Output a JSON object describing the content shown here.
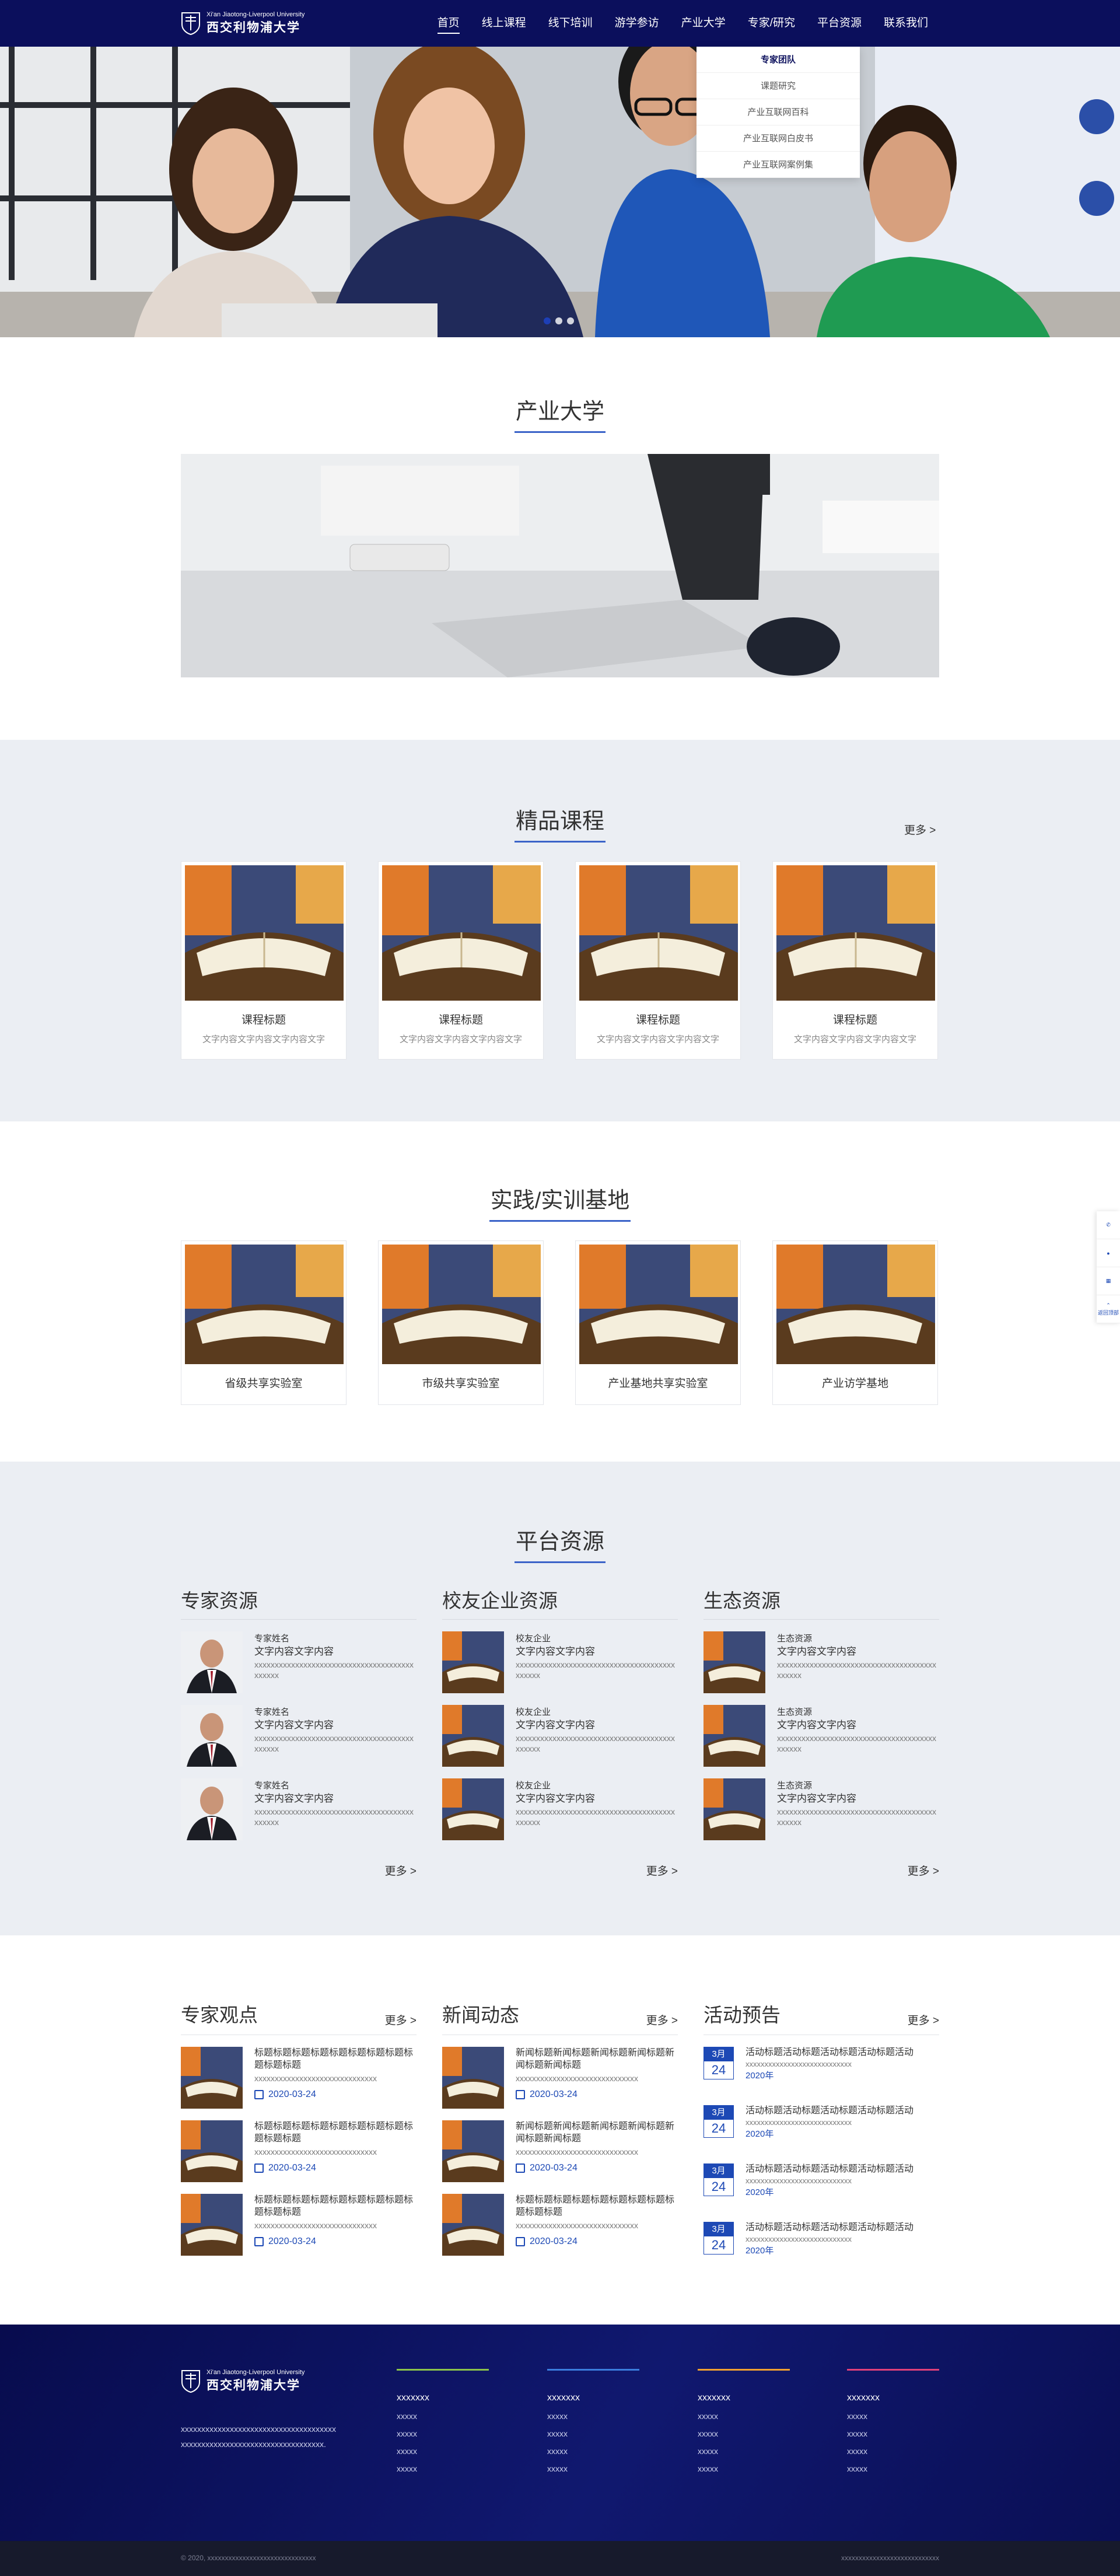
{
  "header": {
    "logo_en": "Xi'an Jiaotong-Liverpool University",
    "logo_cn": "西交利物浦大学",
    "nav": [
      {
        "label": "首页"
      },
      {
        "label": "线上课程"
      },
      {
        "label": "线下培训"
      },
      {
        "label": "游学参访"
      },
      {
        "label": "产业大学"
      },
      {
        "label": "专家/研究"
      },
      {
        "label": "平台资源"
      },
      {
        "label": "联系我们"
      }
    ],
    "dropdown": [
      "专家团队",
      "课题研究",
      "产业互联网百科",
      "产业互联网白皮书",
      "产业互联网案例集"
    ]
  },
  "section_industry_univ": {
    "title": "产业大学"
  },
  "section_courses": {
    "title": "精品课程",
    "more": "更多 >",
    "cards": [
      {
        "title": "课程标题",
        "desc": "文字内容文字内容文字内容文字"
      },
      {
        "title": "课程标题",
        "desc": "文字内容文字内容文字内容文字"
      },
      {
        "title": "课程标题",
        "desc": "文字内容文字内容文字内容文字"
      },
      {
        "title": "课程标题",
        "desc": "文字内容文字内容文字内容文字"
      }
    ]
  },
  "section_bases": {
    "title": "实践/实训基地",
    "cards": [
      {
        "title": "省级共享实验室"
      },
      {
        "title": "市级共享实验室"
      },
      {
        "title": "产业基地共享实验室"
      },
      {
        "title": "产业访学基地"
      }
    ]
  },
  "section_resources": {
    "title": "平台资源",
    "columns": [
      {
        "heading": "专家资源",
        "more": "更多 >",
        "items": [
          {
            "l1": "专家姓名",
            "l2": "文字内容文字内容",
            "l3": "xxxxxxxxxxxxxxxxxxxxxxxxxxxxxxxxxxxxxxxxxxxxx"
          },
          {
            "l1": "专家姓名",
            "l2": "文字内容文字内容",
            "l3": "xxxxxxxxxxxxxxxxxxxxxxxxxxxxxxxxxxxxxxxxxxxxx"
          },
          {
            "l1": "专家姓名",
            "l2": "文字内容文字内容",
            "l3": "xxxxxxxxxxxxxxxxxxxxxxxxxxxxxxxxxxxxxxxxxxxxx"
          }
        ]
      },
      {
        "heading": "校友企业资源",
        "more": "更多 >",
        "items": [
          {
            "l1": "校友企业",
            "l2": "文字内容文字内容",
            "l3": "xxxxxxxxxxxxxxxxxxxxxxxxxxxxxxxxxxxxxxxxxxxxx"
          },
          {
            "l1": "校友企业",
            "l2": "文字内容文字内容",
            "l3": "xxxxxxxxxxxxxxxxxxxxxxxxxxxxxxxxxxxxxxxxxxxxx"
          },
          {
            "l1": "校友企业",
            "l2": "文字内容文字内容",
            "l3": "xxxxxxxxxxxxxxxxxxxxxxxxxxxxxxxxxxxxxxxxxxxxx"
          }
        ]
      },
      {
        "heading": "生态资源",
        "more": "更多 >",
        "items": [
          {
            "l1": "生态资源",
            "l2": "文字内容文字内容",
            "l3": "xxxxxxxxxxxxxxxxxxxxxxxxxxxxxxxxxxxxxxxxxxxxx"
          },
          {
            "l1": "生态资源",
            "l2": "文字内容文字内容",
            "l3": "xxxxxxxxxxxxxxxxxxxxxxxxxxxxxxxxxxxxxxxxxxxxx"
          },
          {
            "l1": "生态资源",
            "l2": "文字内容文字内容",
            "l3": "xxxxxxxxxxxxxxxxxxxxxxxxxxxxxxxxxxxxxxxxxxxxx"
          }
        ]
      }
    ]
  },
  "section_news": {
    "columns": [
      {
        "heading": "专家观点",
        "more": "更多 >",
        "items": [
          {
            "title": "标题标题标题标题标题标题标题标题标题标题标题",
            "x": "xxxxxxxxxxxxxxxxxxxxxxxxxxxxxx",
            "date": "2020-03-24"
          },
          {
            "title": "标题标题标题标题标题标题标题标题标题标题标题",
            "x": "xxxxxxxxxxxxxxxxxxxxxxxxxxxxxx",
            "date": "2020-03-24"
          },
          {
            "title": "标题标题标题标题标题标题标题标题标题标题标题",
            "x": "xxxxxxxxxxxxxxxxxxxxxxxxxxxxxx",
            "date": "2020-03-24"
          }
        ]
      },
      {
        "heading": "新闻动态",
        "more": "更多 >",
        "items": [
          {
            "title": "新闻标题新闻标题新闻标题新闻标题新闻标题新闻标题",
            "x": "xxxxxxxxxxxxxxxxxxxxxxxxxxxxxx",
            "date": "2020-03-24"
          },
          {
            "title": "新闻标题新闻标题新闻标题新闻标题新闻标题新闻标题",
            "x": "xxxxxxxxxxxxxxxxxxxxxxxxxxxxxx",
            "date": "2020-03-24"
          },
          {
            "title": "标题标题标题标题标题标题标题标题标题标题标题",
            "x": "xxxxxxxxxxxxxxxxxxxxxxxxxxxxxx",
            "date": "2020-03-24"
          }
        ]
      },
      {
        "heading": "活动预告",
        "more": "更多 >",
        "items": [
          {
            "mon": "3月",
            "day": "24",
            "title": "活动标题活动标题活动标题活动标题活动",
            "x": "xxxxxxxxxxxxxxxxxxxxxxxxxxxx",
            "year": "2020年"
          },
          {
            "mon": "3月",
            "day": "24",
            "title": "活动标题活动标题活动标题活动标题活动",
            "x": "xxxxxxxxxxxxxxxxxxxxxxxxxxxx",
            "year": "2020年"
          },
          {
            "mon": "3月",
            "day": "24",
            "title": "活动标题活动标题活动标题活动标题活动",
            "x": "xxxxxxxxxxxxxxxxxxxxxxxxxxxx",
            "year": "2020年"
          },
          {
            "mon": "3月",
            "day": "24",
            "title": "活动标题活动标题活动标题活动标题活动",
            "x": "xxxxxxxxxxxxxxxxxxxxxxxxxxxx",
            "year": "2020年"
          }
        ]
      }
    ]
  },
  "footer": {
    "desc": "xxxxxxxxxxxxxxxxxxxxxxxxxxxxxxxxxxxxxxxxxxxxxxxxxxxxxxxxxxxxxxxxxxxxxxxxx.",
    "columns": [
      {
        "heading": "xxxxxxx",
        "color": "#8bc34a",
        "links": [
          "xxxxx",
          "xxxxx",
          "xxxxx",
          "xxxxx"
        ]
      },
      {
        "heading": "xxxxxxx",
        "color": "#3b7ddd",
        "links": [
          "xxxxx",
          "xxxxx",
          "xxxxx",
          "xxxxx"
        ]
      },
      {
        "heading": "xxxxxxx",
        "color": "#f0a030",
        "links": [
          "xxxxx",
          "xxxxx",
          "xxxxx",
          "xxxxx"
        ]
      },
      {
        "heading": "xxxxxxx",
        "color": "#e0407a",
        "links": [
          "xxxxx",
          "xxxxx",
          "xxxxx",
          "xxxxx"
        ]
      }
    ],
    "copyright": "© 2020, xxxxxxxxxxxxxxxxxxxxxxxxxxxxxxx",
    "right_text": "xxxxxxxxxxxxxxxxxxxxxxxxxxxx"
  },
  "sidebar": {
    "last_label": "返回顶部"
  },
  "hero": {
    "slide_count": 3,
    "active_slide": 1
  }
}
